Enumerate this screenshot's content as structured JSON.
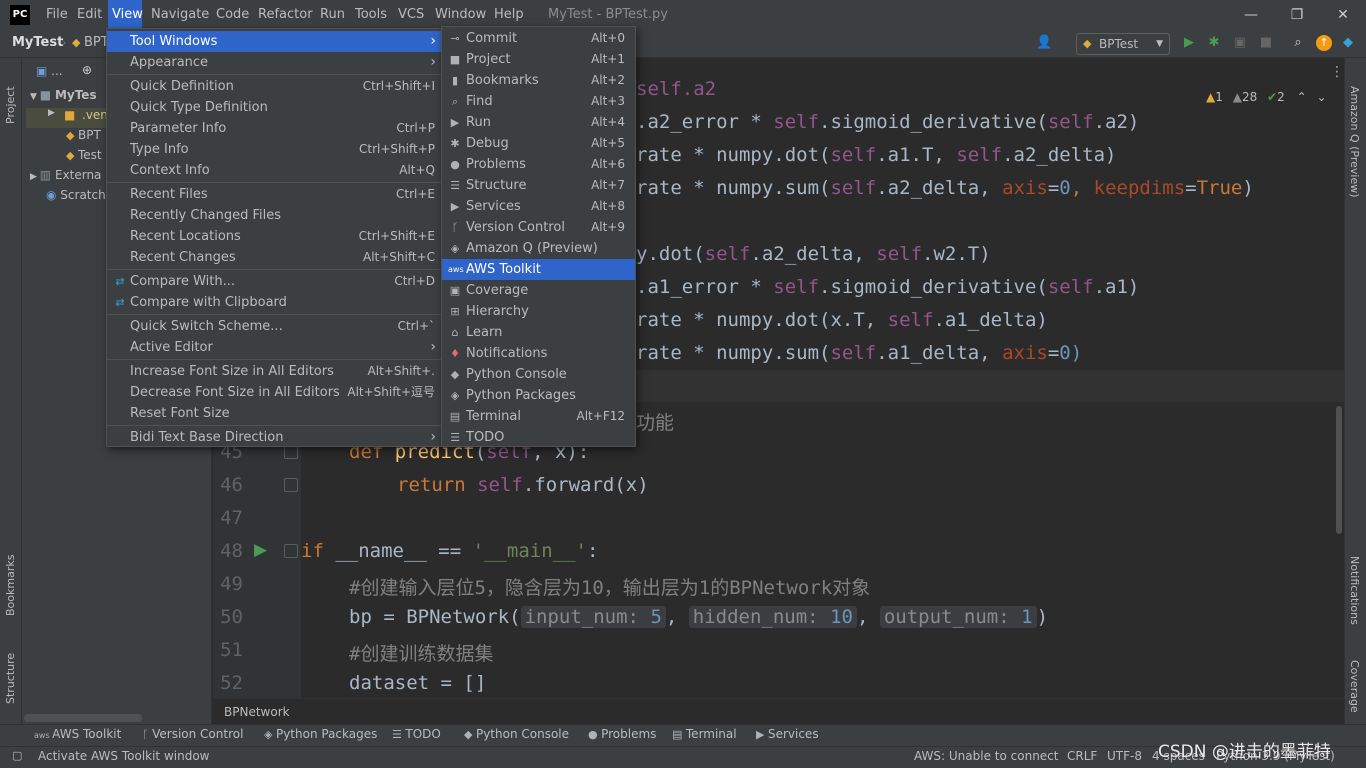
{
  "window": {
    "title": "MyTest - BPTest.py",
    "logo_text": "PC",
    "minimize": "—",
    "restore": "❐",
    "close": "✕"
  },
  "menubar": [
    "File",
    "Edit",
    "View",
    "Navigate",
    "Code",
    "Refactor",
    "Run",
    "Tools",
    "VCS",
    "Window",
    "Help"
  ],
  "toolbar": {
    "project": "MyTest",
    "file_crumb": "BPT",
    "run_config": "BPTest"
  },
  "left_strip": {
    "project": "Project",
    "bookmarks": "Bookmarks",
    "structure": "Structure"
  },
  "right_strip": {
    "amazonq": "Amazon Q (Preview)",
    "notifications": "Notifications",
    "coverage": "Coverage"
  },
  "project_tree": [
    {
      "label": "...",
      "kind": "header"
    },
    {
      "label": "MyTes",
      "kind": "folder"
    },
    {
      "label": ".ven",
      "kind": "folder"
    },
    {
      "label": "BPT",
      "kind": "file"
    },
    {
      "label": "Test",
      "kind": "file"
    },
    {
      "label": "Externa",
      "kind": "lib"
    },
    {
      "label": "Scratch",
      "kind": "scratch"
    }
  ],
  "inspection": {
    "warnings": "1",
    "weak": "28",
    "ok": "2"
  },
  "view_menu": [
    {
      "label": "Tool Windows",
      "submenu": true,
      "selected": true
    },
    {
      "label": "Appearance",
      "submenu": true
    },
    {
      "sep": true
    },
    {
      "label": "Quick Definition",
      "shortcut": "Ctrl+Shift+I"
    },
    {
      "label": "Quick Type Definition"
    },
    {
      "label": "Parameter Info",
      "shortcut": "Ctrl+P"
    },
    {
      "label": "Type Info",
      "shortcut": "Ctrl+Shift+P"
    },
    {
      "label": "Context Info",
      "shortcut": "Alt+Q"
    },
    {
      "sep": true
    },
    {
      "label": "Recent Files",
      "shortcut": "Ctrl+E"
    },
    {
      "label": "Recently Changed Files"
    },
    {
      "label": "Recent Locations",
      "shortcut": "Ctrl+Shift+E"
    },
    {
      "label": "Recent Changes",
      "shortcut": "Alt+Shift+C"
    },
    {
      "sep": true
    },
    {
      "label": "Compare With...",
      "shortcut": "Ctrl+D",
      "icon": "compare-icon"
    },
    {
      "label": "Compare with Clipboard",
      "icon": "compare-icon"
    },
    {
      "sep": true
    },
    {
      "label": "Quick Switch Scheme...",
      "shortcut": "Ctrl+`"
    },
    {
      "label": "Active Editor",
      "submenu": true
    },
    {
      "sep": true
    },
    {
      "label": "Increase Font Size in All Editors",
      "shortcut": "Alt+Shift+."
    },
    {
      "label": "Decrease Font Size in All Editors",
      "shortcut": "Alt+Shift+逗号"
    },
    {
      "label": "Reset Font Size"
    },
    {
      "sep": true
    },
    {
      "label": "Bidi Text Base Direction",
      "submenu": true
    }
  ],
  "tool_windows_menu": [
    {
      "label": "Commit",
      "shortcut": "Alt+0",
      "icon": "commit-icon"
    },
    {
      "label": "Project",
      "shortcut": "Alt+1",
      "icon": "folder-icon"
    },
    {
      "label": "Bookmarks",
      "shortcut": "Alt+2",
      "icon": "bookmark-icon"
    },
    {
      "label": "Find",
      "shortcut": "Alt+3",
      "icon": "search-icon"
    },
    {
      "label": "Run",
      "shortcut": "Alt+4",
      "icon": "run-icon"
    },
    {
      "label": "Debug",
      "shortcut": "Alt+5",
      "icon": "debug-icon"
    },
    {
      "label": "Problems",
      "shortcut": "Alt+6",
      "icon": "problems-icon"
    },
    {
      "label": "Structure",
      "shortcut": "Alt+7",
      "icon": "structure-icon"
    },
    {
      "label": "Services",
      "shortcut": "Alt+8",
      "icon": "services-icon"
    },
    {
      "label": "Version Control",
      "shortcut": "Alt+9",
      "icon": "vcs-icon"
    },
    {
      "label": "Amazon Q (Preview)",
      "icon": "amazonq-icon"
    },
    {
      "label": "AWS Toolkit",
      "icon": "aws-icon",
      "selected": true
    },
    {
      "label": "Coverage",
      "icon": "coverage-icon"
    },
    {
      "label": "Hierarchy",
      "icon": "hierarchy-icon"
    },
    {
      "label": "Learn",
      "icon": "learn-icon"
    },
    {
      "label": "Notifications",
      "icon": "bell-icon"
    },
    {
      "label": "Python Console",
      "icon": "python-console-icon"
    },
    {
      "label": "Python Packages",
      "icon": "packages-icon"
    },
    {
      "label": "Terminal",
      "shortcut": "Alt+F12",
      "icon": "terminal-icon"
    },
    {
      "label": "TODO",
      "icon": "todo-icon"
    }
  ],
  "code": {
    "line_numbers": [
      "45",
      "46",
      "47",
      "48",
      "49",
      "50",
      "51",
      "52"
    ],
    "frag_a2": "self.a2",
    "frag_a2_error": ".a2_error * ",
    "frag_self": "self",
    "frag_sigmoid_a2": ".sigmoid_derivative(",
    "frag_self_a2_end": ".a2)",
    "frag_rate_dot": "rate * numpy.dot(",
    "frag_a1T": ".a1.T, ",
    "frag_a2_delta_end": ".a2_delta)",
    "frag_rate_sum": "rate * numpy.sum(",
    "frag_a2_delta_c": ".a2_delta, ",
    "frag_axis": "axis",
    "frag_eq0": "=",
    "frag_zero": "0",
    "frag_comma": ", ",
    "frag_keepdims": "keepdims",
    "frag_true": "True",
    "frag_close": ")",
    "frag_ydot": "y.dot(",
    "frag_w2T": ".w2.T)",
    "frag_a1_error": ".a1_error * ",
    "frag_self_a1_end": ".a1)",
    "frag_rate_dot_x": "rate * numpy.dot(x.T, ",
    "frag_a1_delta_end": ".a1_delta)",
    "frag_a1_delta_c": ".a1_delta, ",
    "frag_zero_close": "0)",
    "comment_partial": "功能",
    "def_kw": "def ",
    "predict": "predict",
    "predict_args_open": "(",
    "predict_args_self": "self",
    "predict_args_rest": ", x):",
    "return_kw": "return ",
    "return_rest": ".forward(x)",
    "if_kw": "if ",
    "name_cmp": "__name__ == ",
    "main_str": "'__main__'",
    "colon": ":",
    "comment1": "#创建输入层位5，隐含层为10，输出层为1的BPNetwork对象",
    "bp_assign": "bp = BPNetwork(",
    "hint1_name": "input_num:",
    "hint1_val": "5",
    "hint2_name": "hidden_num:",
    "hint2_val": "10",
    "hint3_name": "output_num:",
    "hint3_val": "1",
    "comment2": "#创建训练数据集",
    "dataset": "dataset = []"
  },
  "editor_breadcrumb": "BPNetwork",
  "bottom_tools": [
    {
      "label": "AWS Toolkit",
      "icon": "aws-icon"
    },
    {
      "label": "Version Control",
      "icon": "vcs-icon"
    },
    {
      "label": "Python Packages",
      "icon": "packages-icon"
    },
    {
      "label": "TODO",
      "icon": "todo-icon"
    },
    {
      "label": "Python Console",
      "icon": "python-console-icon"
    },
    {
      "label": "Problems",
      "icon": "problems-icon"
    },
    {
      "label": "Terminal",
      "icon": "terminal-icon"
    },
    {
      "label": "Services",
      "icon": "services-icon"
    }
  ],
  "status": {
    "message": "Activate AWS Toolkit window",
    "aws": "AWS: Unable to connect",
    "line_sep": "CRLF",
    "encoding": "UTF-8",
    "indent": "4 spaces",
    "interpreter": "Python 3.9 (MyTest)"
  },
  "watermark": "CSDN @进击的墨菲特",
  "colors": {
    "accent": "#2f65ca",
    "keyword": "#cc7832",
    "self": "#94558d",
    "number": "#6897bb",
    "string": "#6a8759",
    "run_green": "#499c54",
    "warning": "#e0a93a"
  }
}
